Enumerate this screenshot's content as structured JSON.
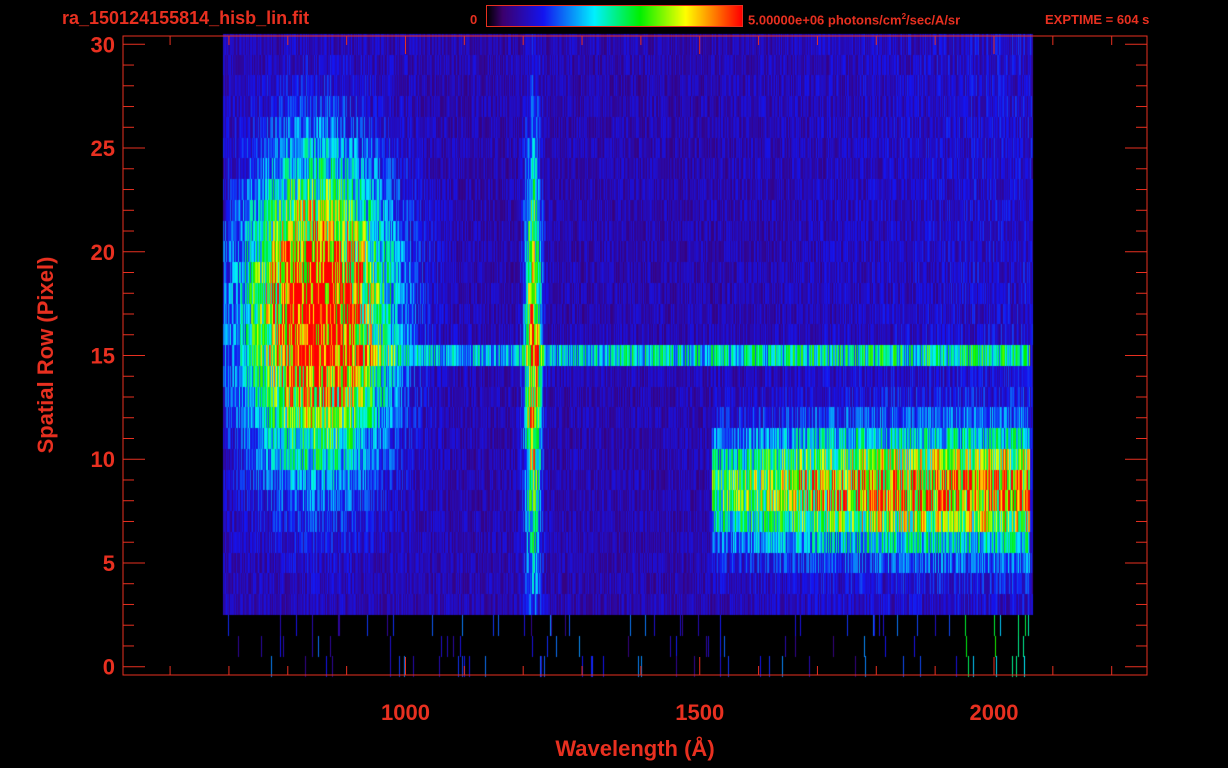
{
  "colors": {
    "axis": "#e83020"
  },
  "header": {
    "file_title": "ra_150124155814_hisb_lin.fit",
    "colorbar_min": "0",
    "colorbar_max_prefix": "5.00000e+06 photons/cm",
    "colorbar_max_exp": "2",
    "colorbar_max_suffix": "/sec/A/sr",
    "exptime": "EXPTIME = 604 s"
  },
  "chart_data": {
    "type": "heatmap",
    "xlabel": "Wavelength (Å)",
    "ylabel": "Spatial Row (Pixel)",
    "xlim": [
      520,
      2260
    ],
    "ylim": [
      -0.4,
      30.4
    ],
    "x_ticks": [
      1000,
      1500,
      2000
    ],
    "y_ticks": [
      0,
      5,
      10,
      15,
      20,
      25,
      30
    ],
    "colorbar_range": [
      0,
      5000000
    ],
    "colormap": "rainbow",
    "grid": false,
    "features": [
      {
        "label": "broad bright emission",
        "x_center": 850,
        "y_center": 17,
        "x_width": 220,
        "y_width": 13,
        "intensity": 1.0
      },
      {
        "label": "narrow emission line",
        "x_center": 1216,
        "y_center": 14.5,
        "x_width": 25,
        "y_width": 18,
        "intensity": 0.75
      },
      {
        "label": "continuum band",
        "x_range": [
          1520,
          2060
        ],
        "y_center": 8.5,
        "y_width": 5,
        "intensity": 0.7
      },
      {
        "label": "emission row",
        "x_range": [
          900,
          2060
        ],
        "y_center": 15,
        "y_width": 1,
        "intensity": 0.3
      }
    ],
    "data_extent": {
      "x_range": [
        690,
        2065
      ],
      "y_range": [
        3,
        30
      ]
    }
  }
}
